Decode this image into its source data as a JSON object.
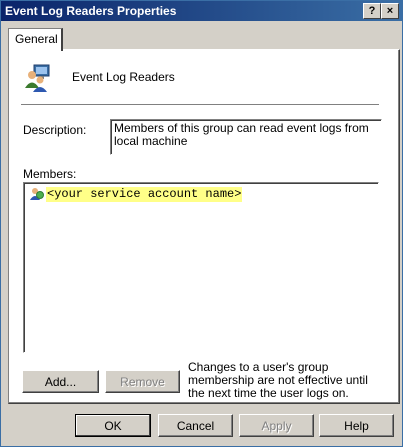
{
  "window": {
    "title": "Event Log Readers Properties",
    "help_glyph": "?",
    "close_glyph": "×"
  },
  "tabs": [
    {
      "label": "General",
      "active": true
    }
  ],
  "group": {
    "name": "Event Log Readers",
    "icon": "group-icon"
  },
  "description": {
    "label": "Description:",
    "value": "Members of this group can read event logs from local machine"
  },
  "members": {
    "label": "Members:",
    "items": [
      {
        "name": "<your service account name>",
        "icon": "user-icon"
      }
    ]
  },
  "buttons": {
    "add": "Add...",
    "remove": "Remove",
    "ok": "OK",
    "cancel": "Cancel",
    "apply": "Apply",
    "help": "Help"
  },
  "note": "Changes to a user's group membership are not effective until the next time the user logs on.",
  "colors": {
    "titlebar": "#0a246a",
    "face": "#d4d0c8",
    "highlight": "#ffff88"
  }
}
